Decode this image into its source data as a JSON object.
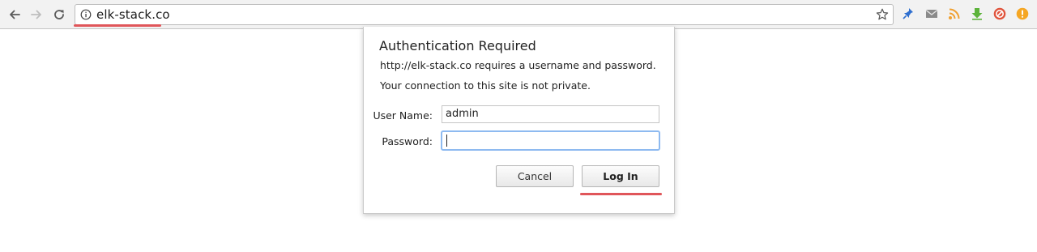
{
  "browser": {
    "url": "elk-stack.co",
    "nav": {
      "back_icon": "arrow-left-icon",
      "forward_icon": "arrow-right-icon",
      "reload_icon": "reload-icon"
    },
    "omnibox_icons": {
      "info_icon": "info-icon",
      "bookmark_icon": "star-icon"
    },
    "extensions": [
      {
        "name": "pushpin-extension-icon",
        "color": "#2f6fcf"
      },
      {
        "name": "mail-extension-icon",
        "color": "#8a8a8a"
      },
      {
        "name": "rss-extension-icon",
        "color": "#f0a030"
      },
      {
        "name": "download-extension-icon",
        "color": "#5cb33a"
      },
      {
        "name": "block-extension-icon",
        "color": "#e0533b"
      },
      {
        "name": "alert-extension-icon",
        "color": "#f5a623"
      }
    ]
  },
  "dialog": {
    "title": "Authentication Required",
    "message_1": "http://elk-stack.co requires a username and password.",
    "message_2": "Your connection to this site is not private.",
    "username_label": "User Name:",
    "username_value": "admin",
    "password_label": "Password:",
    "password_value": "",
    "cancel_label": "Cancel",
    "login_label": "Log In"
  },
  "colors": {
    "highlight_underline": "#e0565a",
    "focus_ring": "#8ebaf0"
  }
}
